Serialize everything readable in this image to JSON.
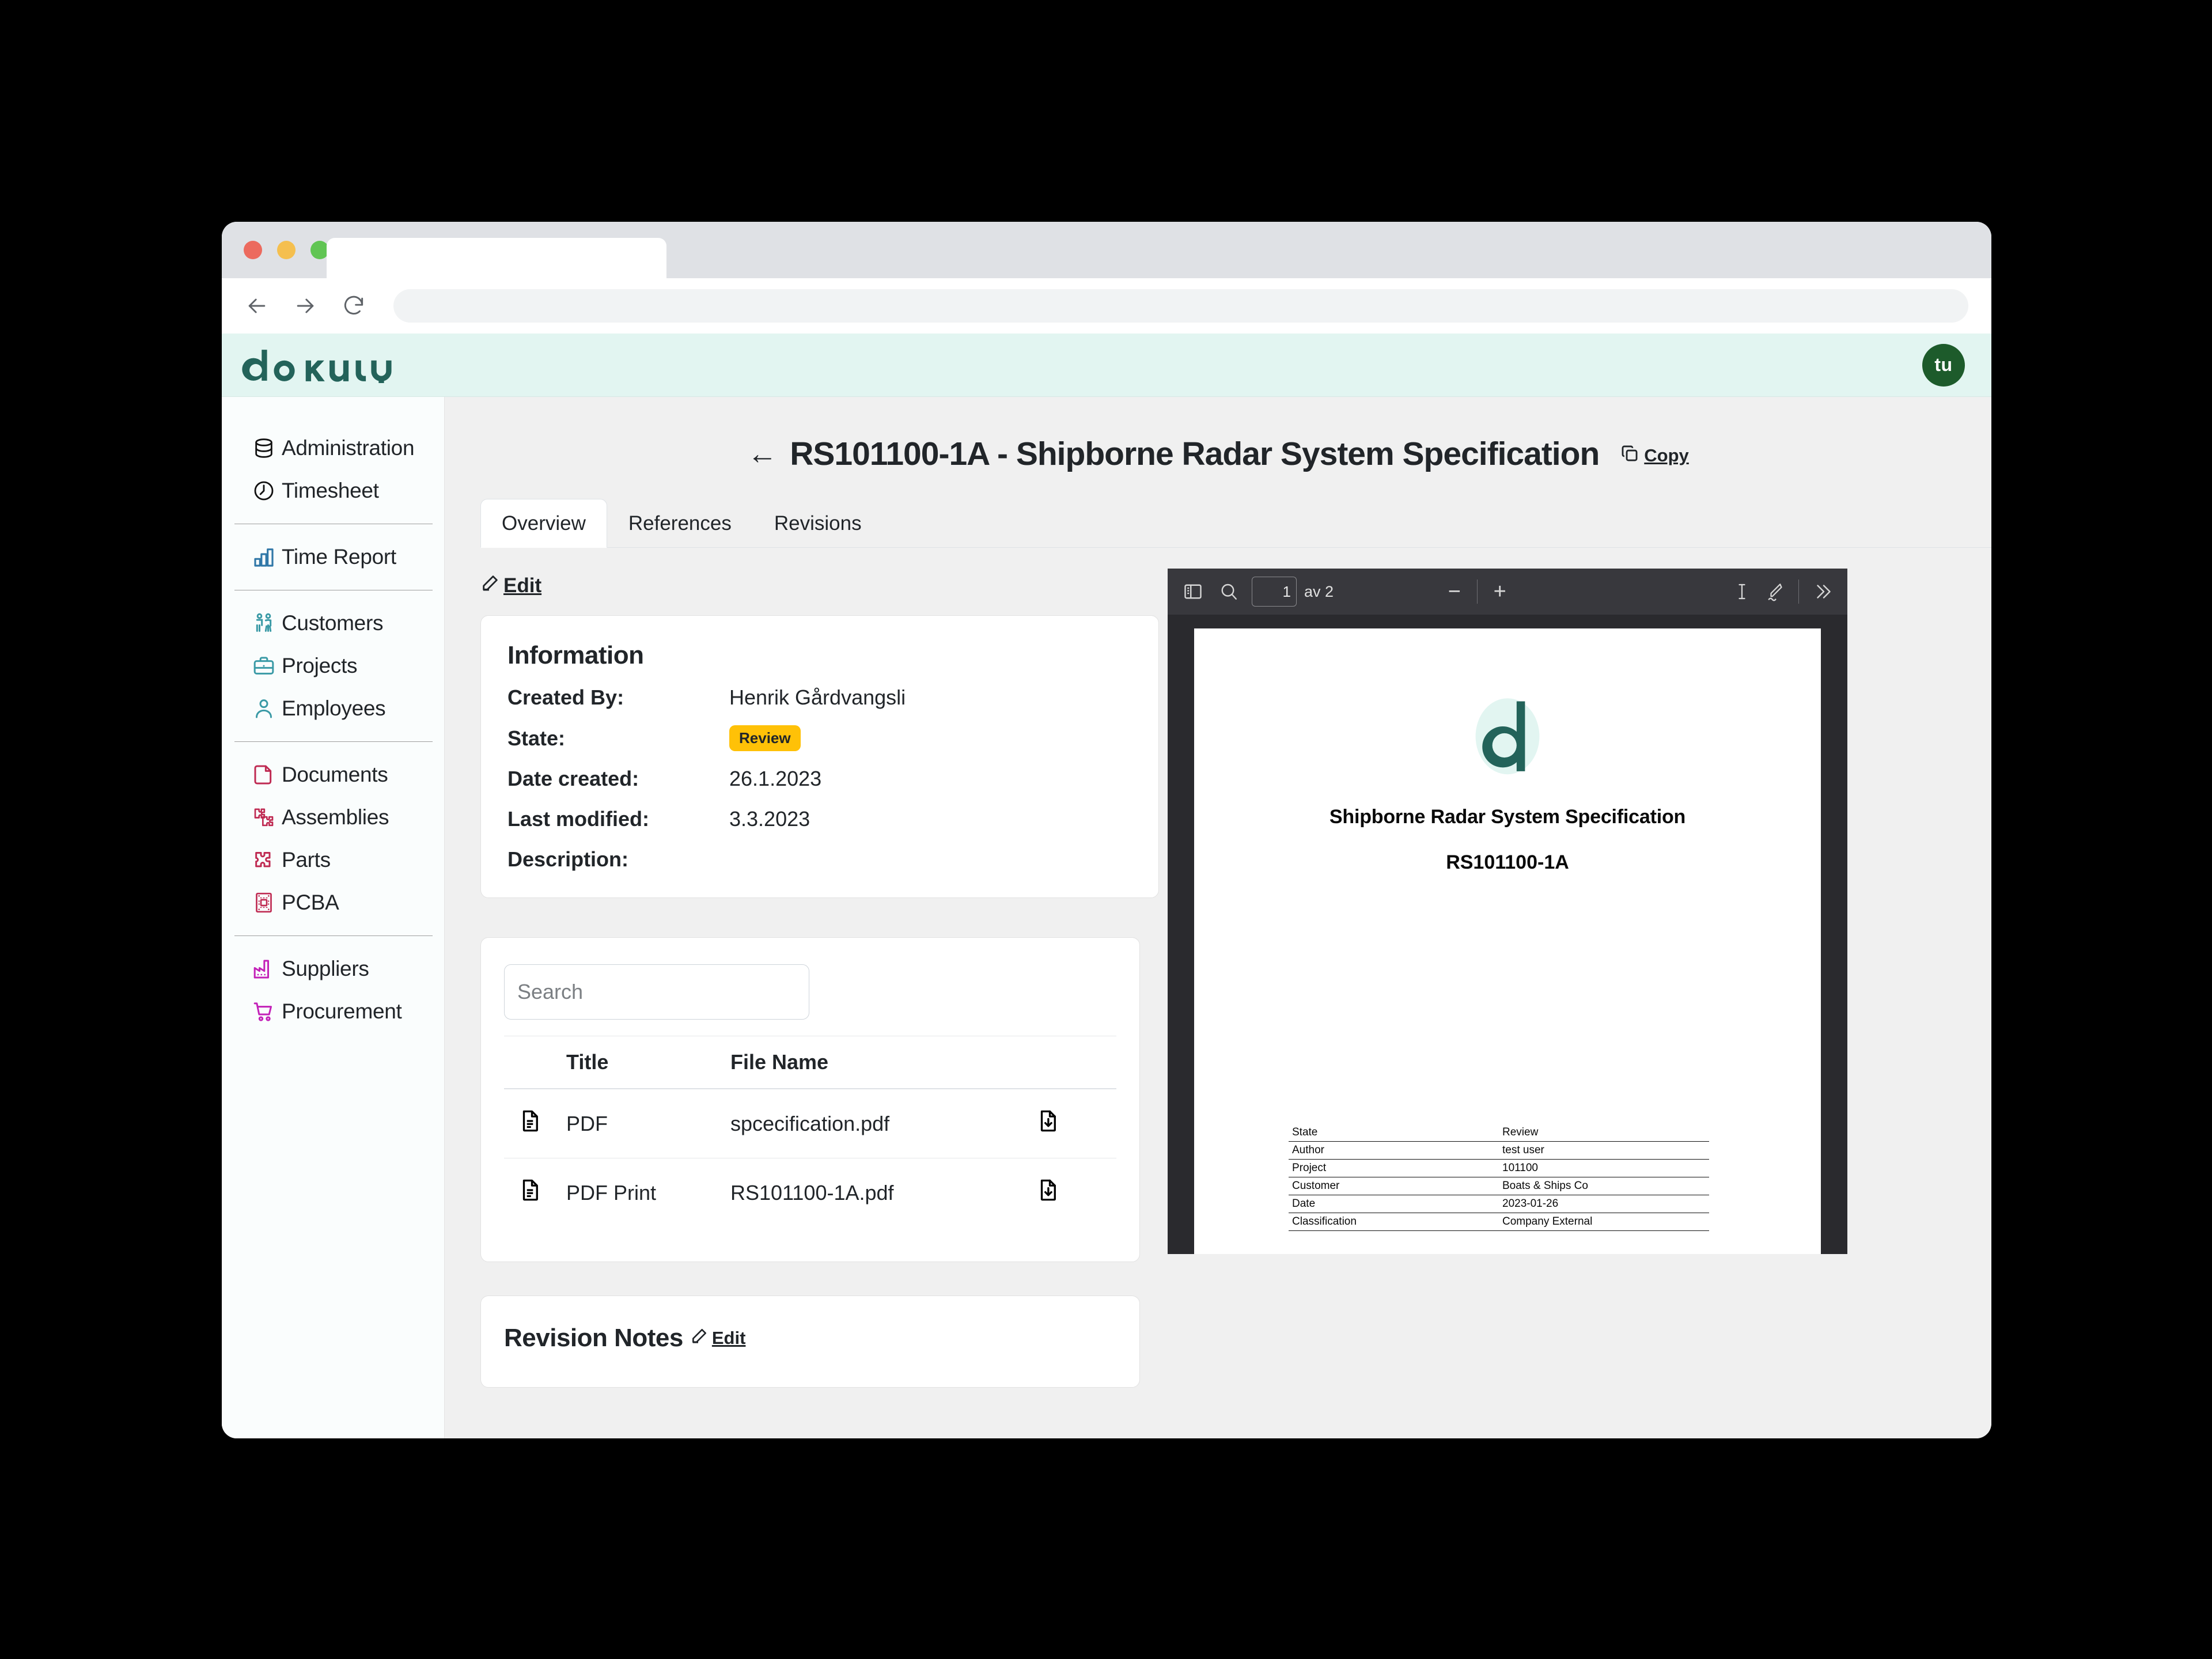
{
  "browser": {
    "back_icon": "arrow-left-icon",
    "forward_icon": "arrow-right-icon",
    "reload_icon": "reload-icon",
    "tab_label": "",
    "url_value": ""
  },
  "app": {
    "logo_text": "dokuly",
    "avatar_initials": "tu",
    "accent_color": "#2b6e62",
    "header_bg": "#e2f5f1"
  },
  "sidebar": {
    "groups": [
      {
        "items": [
          {
            "label": "Administration",
            "icon": "database-icon",
            "color": "#111111"
          },
          {
            "label": "Timesheet",
            "icon": "clock-icon",
            "color": "#111111"
          }
        ]
      },
      {
        "items": [
          {
            "label": "Time Report",
            "icon": "bar-chart-icon",
            "color": "#3178a8"
          }
        ]
      },
      {
        "items": [
          {
            "label": "Customers",
            "icon": "people-icon",
            "color": "#3a9aa6"
          },
          {
            "label": "Projects",
            "icon": "briefcase-icon",
            "color": "#3a9aa6"
          },
          {
            "label": "Employees",
            "icon": "person-icon",
            "color": "#3a9aa6"
          }
        ]
      },
      {
        "items": [
          {
            "label": "Documents",
            "icon": "document-icon",
            "color": "#bf2a52"
          },
          {
            "label": "Assemblies",
            "icon": "puzzle-pieces-icon",
            "color": "#bf2a52"
          },
          {
            "label": "Parts",
            "icon": "puzzle-piece-icon",
            "color": "#bf2a52"
          },
          {
            "label": "PCBA",
            "icon": "circuit-board-icon",
            "color": "#bf2a52"
          }
        ]
      },
      {
        "items": [
          {
            "label": "Suppliers",
            "icon": "factory-icon",
            "color": "#c321b8"
          },
          {
            "label": "Procurement",
            "icon": "shopping-cart-icon",
            "color": "#c321b8"
          }
        ]
      }
    ]
  },
  "page": {
    "back_arrow": "←",
    "title": "RS101100-1A - Shipborne Radar System Specification",
    "copy_label": "Copy",
    "copy_icon": "copy-icon",
    "tabs": [
      {
        "label": "Overview",
        "active": true
      },
      {
        "label": "References",
        "active": false
      },
      {
        "label": "Revisions",
        "active": false
      }
    ],
    "edit_label": "Edit",
    "edit_icon": "pencil-square-icon"
  },
  "information": {
    "heading": "Information",
    "rows": [
      {
        "label": "Created By:",
        "value": "Henrik Gårdvangsli",
        "type": "text"
      },
      {
        "label": "State:",
        "value": "Review",
        "type": "badge",
        "badge_color": "#ffc107"
      },
      {
        "label": "Date created:",
        "value": "26.1.2023",
        "type": "text"
      },
      {
        "label": "Last modified:",
        "value": "3.3.2023",
        "type": "text"
      },
      {
        "label": "Description:",
        "value": "",
        "type": "text"
      }
    ]
  },
  "files": {
    "search_placeholder": "Search",
    "search_value": "",
    "columns": [
      "",
      "Title",
      "File Name",
      ""
    ],
    "rows": [
      {
        "icon": "file-text-icon",
        "title": "PDF",
        "file_name": "spcecification.pdf",
        "action_icon": "file-download-icon"
      },
      {
        "icon": "file-text-icon",
        "title": "PDF Print",
        "file_name": "RS101100-1A.pdf",
        "action_icon": "file-download-icon"
      }
    ]
  },
  "revision_notes": {
    "heading": "Revision Notes",
    "edit_label": "Edit",
    "edit_icon": "pencil-square-icon"
  },
  "pdf_viewer": {
    "toolbar": {
      "sidebar_toggle_icon": "sidebar-toggle-icon",
      "find_icon": "search-icon",
      "page_number": "1",
      "page_total": "av 2",
      "zoom_out": "−",
      "zoom_in": "+",
      "text_select_icon": "text-cursor-icon",
      "draw_icon": "pencil-draw-icon",
      "more_tools_icon": "chevron-double-right-icon"
    },
    "document": {
      "logo_letter": "d",
      "title": "Shipborne Radar System Specification",
      "number": "RS101100-1A",
      "meta_table": [
        {
          "key": "State",
          "value": "Review"
        },
        {
          "key": "Author",
          "value": "test user"
        },
        {
          "key": "Project",
          "value": "101100"
        },
        {
          "key": "Customer",
          "value": "Boats & Ships Co"
        },
        {
          "key": "Date",
          "value": "2023-01-26"
        },
        {
          "key": "Classification",
          "value": "Company External"
        }
      ]
    }
  }
}
